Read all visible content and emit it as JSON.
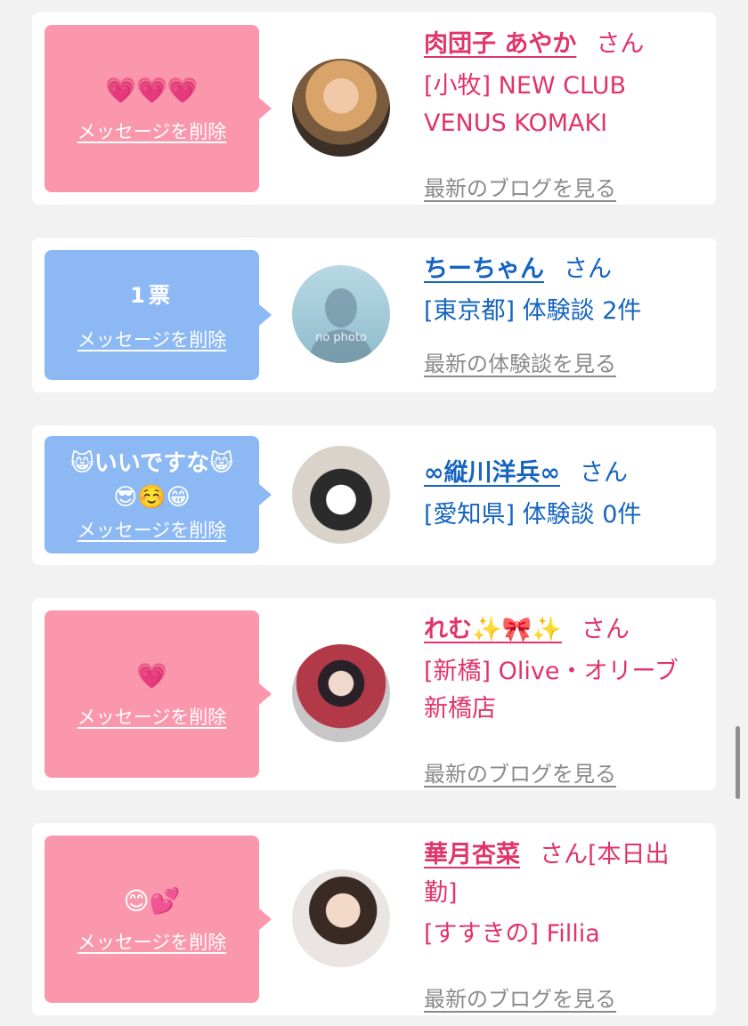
{
  "colors": {
    "pink_bubble": "#fb97ac",
    "blue_bubble": "#8cb8f4",
    "pink_text": "#e0346a",
    "blue_text": "#1565c0",
    "gray_link": "#8a8a8a"
  },
  "cards": [
    {
      "message": "💗💗💗",
      "message2": "",
      "delete_label": "メッセージを削除",
      "name": "肉団子 あやか",
      "san": "さん",
      "shop_line1": "[小牧] NEW CLUB",
      "shop_line2": "VENUS KOMAKI",
      "link": "最新のブログを見る",
      "avatar": "woman-photo-blonde"
    },
    {
      "message": "1票",
      "message2": "",
      "delete_label": "メッセージを削除",
      "name": "ちーちゃん",
      "san": "さん",
      "shop_line1": "[東京都] 体験談 2件",
      "shop_line2": "",
      "link": "最新の体験談を見る",
      "avatar_text": "no photo"
    },
    {
      "message": "😸いいですな😸",
      "message2": "😎☺️😁",
      "delete_label": "メッセージを削除",
      "name": "∞縦川洋兵∞",
      "san": "さん",
      "shop_line1": "[愛知県] 体験談 0件",
      "shop_line2": "",
      "link": "",
      "avatar": "dog-figure"
    },
    {
      "message": "💗",
      "message2": "",
      "delete_label": "メッセージを削除",
      "name": "れむ✨🎀✨",
      "san": "さん",
      "shop_line1": "[新橋] Olive・オリーブ",
      "shop_line2": "新橋店",
      "link": "最新のブログを見る",
      "avatar": "woman-kimono"
    },
    {
      "message": "😊💕",
      "message2": "",
      "delete_label": "メッセージを削除",
      "name": "華月杏菜",
      "san": "さん[本日出",
      "san2": "勤]",
      "shop_line1": "[すすきの] Fillia",
      "shop_line2": "",
      "link": "最新のブログを見る",
      "avatar": "woman-dark-hair"
    }
  ]
}
